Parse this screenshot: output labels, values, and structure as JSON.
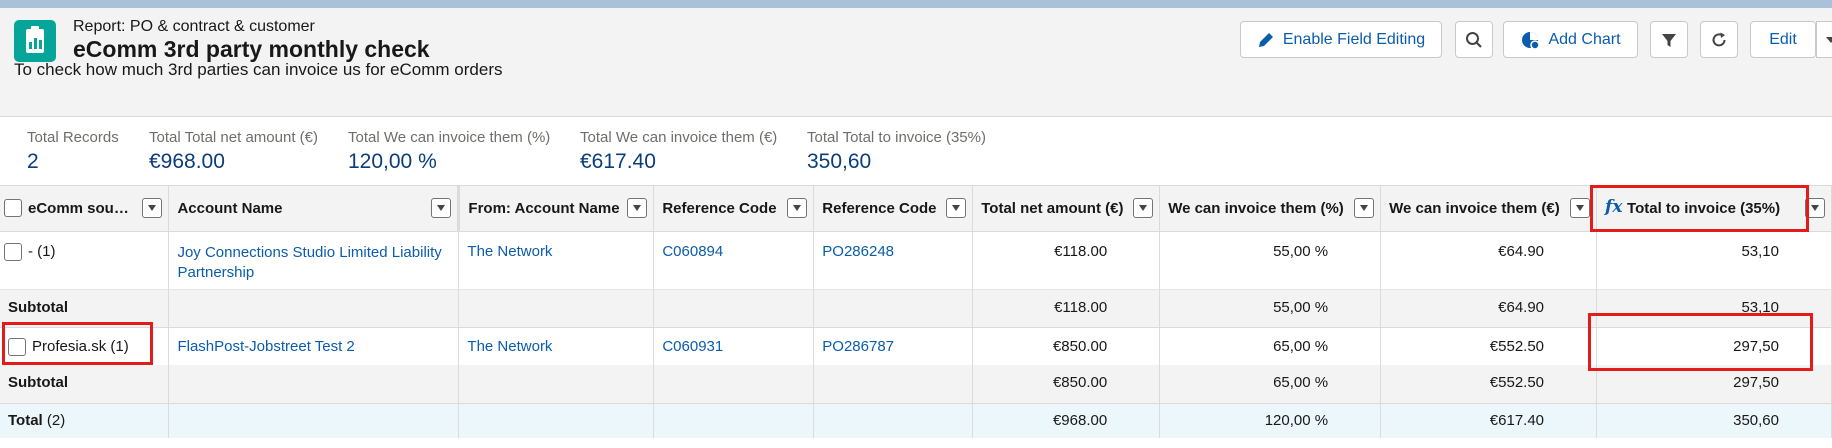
{
  "report": {
    "type_label": "Report: PO & contract & customer",
    "title": "eComm 3rd party monthly check",
    "description": "To check how much 3rd parties can invoice us for eComm orders"
  },
  "toolbar": {
    "enable_editing": "Enable Field Editing",
    "add_chart": "Add Chart",
    "edit": "Edit"
  },
  "summary": [
    {
      "label": "Total Records",
      "value": "2"
    },
    {
      "label": "Total Total net amount (€)",
      "value": "€968.00"
    },
    {
      "label": "Total We can invoice them (%)",
      "value": "120,00 %"
    },
    {
      "label": "Total We can invoice them (€)",
      "value": "€617.40"
    },
    {
      "label": "Total Total to invoice (35%)",
      "value": "350,60"
    }
  ],
  "columns": [
    "eComm sou…",
    "Account Name",
    "From: Account Name",
    "Reference Code",
    "Reference Code",
    "Total net amount (€)",
    "We can invoice them (%)",
    "We can invoice them (€)",
    "Total to invoice (35%)"
  ],
  "groups": [
    {
      "group_label": "- (1)",
      "row": {
        "account": "Joy Connections Studio Limited Liability Partnership",
        "from_account": "The Network",
        "ref1": "C060894",
        "ref2": "PO286248",
        "net": "€118.00",
        "pct": "55,00 %",
        "eur": "€64.90",
        "total": "53,10"
      },
      "subtotal": {
        "label": "Subtotal",
        "net": "€118.00",
        "pct": "55,00 %",
        "eur": "€64.90",
        "total": "53,10"
      }
    },
    {
      "group_label": "Profesia.sk (1)",
      "row": {
        "account": "FlashPost-Jobstreet Test 2",
        "from_account": "The Network",
        "ref1": "C060931",
        "ref2": "PO286787",
        "net": "€850.00",
        "pct": "65,00 %",
        "eur": "€552.50",
        "total": "297,50"
      },
      "subtotal": {
        "label": "Subtotal",
        "net": "€850.00",
        "pct": "65,00 %",
        "eur": "€552.50",
        "total": "297,50"
      }
    }
  ],
  "grand_total": {
    "label": "Total",
    "count": "(2)",
    "net": "€968.00",
    "pct": "120,00 %",
    "eur": "€617.40",
    "total": "350,60"
  },
  "colors": {
    "accent": "#0b5cab",
    "app_icon": "#06a59a",
    "highlight": "#e41b1b"
  }
}
